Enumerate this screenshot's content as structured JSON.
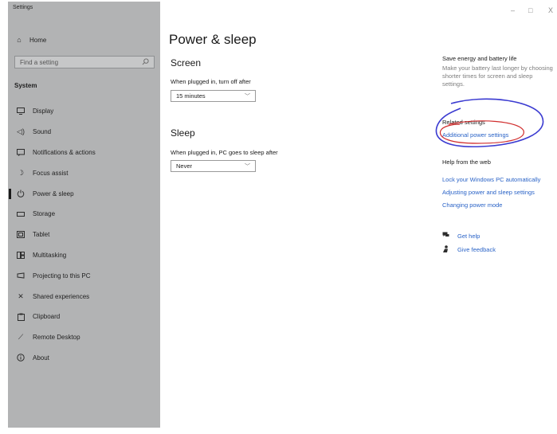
{
  "window": {
    "title": "Settings",
    "minimize_glyph": "–",
    "maximize_glyph": "□",
    "close_glyph": "X"
  },
  "sidebar": {
    "home_label": "Home",
    "search_placeholder": "Find a setting",
    "section_title": "System",
    "items": [
      {
        "label": "Display",
        "icon": "monitor-icon"
      },
      {
        "label": "Sound",
        "icon": "speaker-icon"
      },
      {
        "label": "Notifications & actions",
        "icon": "notification-icon"
      },
      {
        "label": "Focus assist",
        "icon": "moon-icon"
      },
      {
        "label": "Power & sleep",
        "icon": "power-icon",
        "selected": true
      },
      {
        "label": "Storage",
        "icon": "storage-icon"
      },
      {
        "label": "Tablet",
        "icon": "tablet-icon"
      },
      {
        "label": "Multitasking",
        "icon": "multitasking-icon"
      },
      {
        "label": "Projecting to this PC",
        "icon": "projector-icon"
      },
      {
        "label": "Shared experiences",
        "icon": "shared-icon"
      },
      {
        "label": "Clipboard",
        "icon": "clipboard-icon"
      },
      {
        "label": "Remote Desktop",
        "icon": "remote-desktop-icon"
      },
      {
        "label": "About",
        "icon": "info-icon"
      }
    ]
  },
  "main": {
    "page_title": "Power & sleep",
    "screen": {
      "heading": "Screen",
      "label": "When plugged in, turn off after",
      "value": "15 minutes"
    },
    "sleep": {
      "heading": "Sleep",
      "label": "When plugged in, PC goes to sleep after",
      "value": "Never"
    }
  },
  "right_panel": {
    "save_heading": "Save energy and battery life",
    "save_desc": "Make your battery last longer by choosing shorter times for screen and sleep settings.",
    "related_heading": "Related settings",
    "additional_power_link": "Additional power settings",
    "help_heading": "Help from the web",
    "help_links": [
      "Lock your Windows PC automatically",
      "Adjusting power and sleep settings",
      "Changing power mode"
    ],
    "get_help": "Get help",
    "give_feedback": "Give feedback"
  },
  "colors": {
    "sidebar_bg": "#b2b3b4",
    "link": "#2a63c7",
    "annotation_blue": "#3b3bd1",
    "annotation_red": "#d02c2c"
  }
}
